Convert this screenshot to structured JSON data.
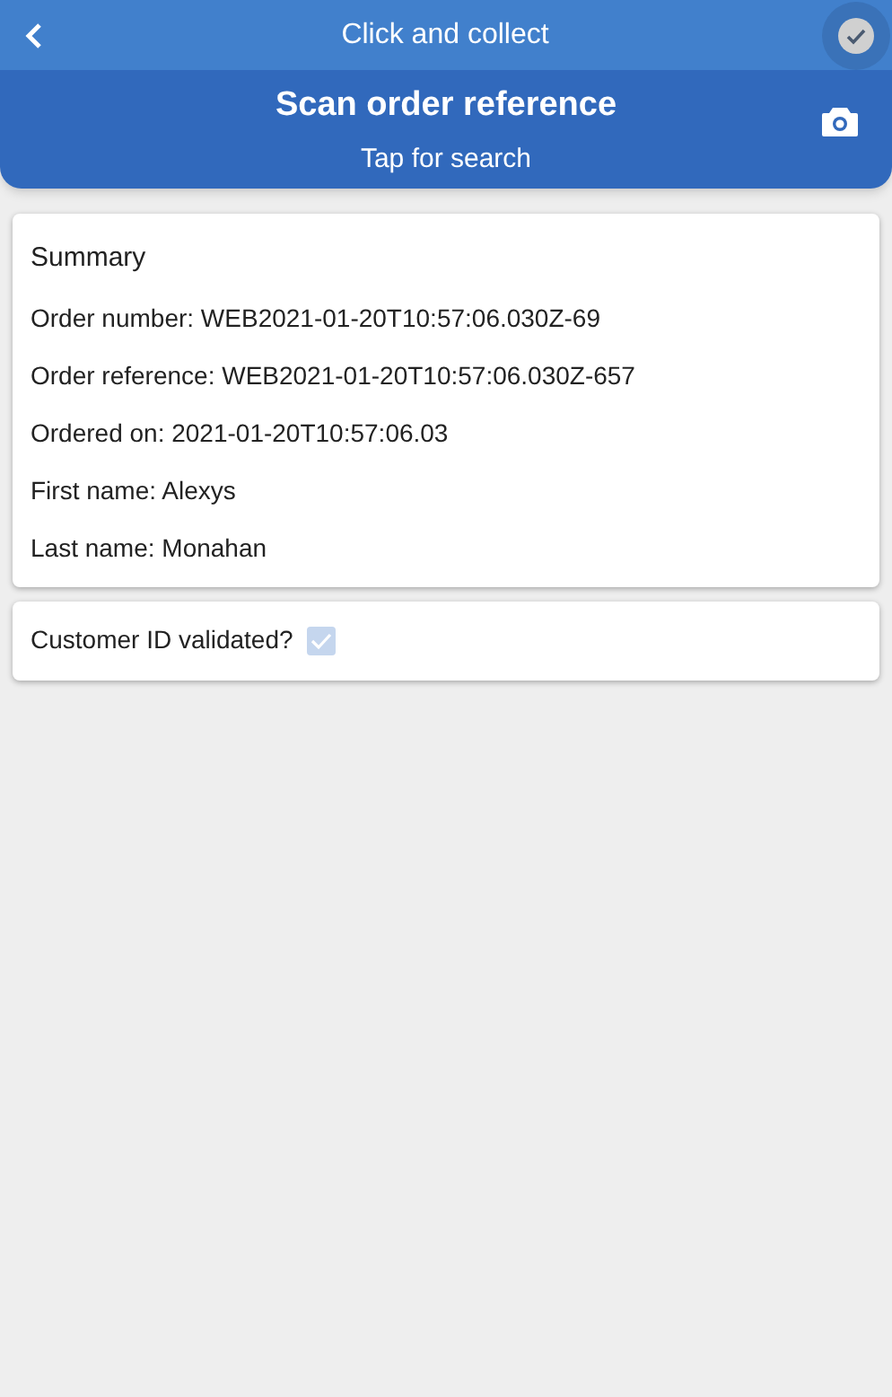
{
  "header": {
    "title": "Click and collect",
    "confirm": {
      "disabled": true
    }
  },
  "scan": {
    "title": "Scan order reference",
    "subtitle": "Tap for search"
  },
  "summary": {
    "title": "Summary",
    "lines": [
      "Order number: WEB2021-01-20T10:57:06.030Z-69",
      "Order reference: WEB2021-01-20T10:57:06.030Z-657",
      "Ordered on: 2021-01-20T10:57:06.03",
      "First name: Alexys",
      "Last name: Monahan"
    ]
  },
  "validation": {
    "label": "Customer ID validated?",
    "checked": true,
    "disabled": true
  }
}
